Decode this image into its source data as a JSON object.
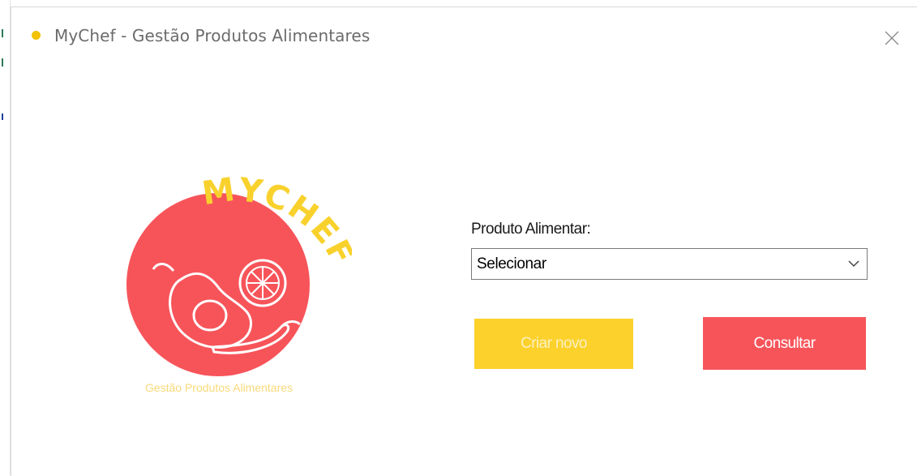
{
  "window": {
    "title": "MyChef - Gestão Produtos Alimentares",
    "close_icon": "close-icon",
    "accent_dot_color": "#f2c200"
  },
  "logo": {
    "brand_text": "MYCHEF",
    "caption": "Gestão Produtos Alimentares",
    "circle_color": "#f7545a",
    "text_color": "#f9d12c"
  },
  "form": {
    "label": "Produto Alimentar:",
    "selected_value": "Selecionar",
    "dropdown_icon": "chevron-down-icon"
  },
  "buttons": {
    "create_label": "Criar novo",
    "create_color": "#fcd12c",
    "consult_label": "Consultar",
    "consult_color": "#f7545a"
  }
}
